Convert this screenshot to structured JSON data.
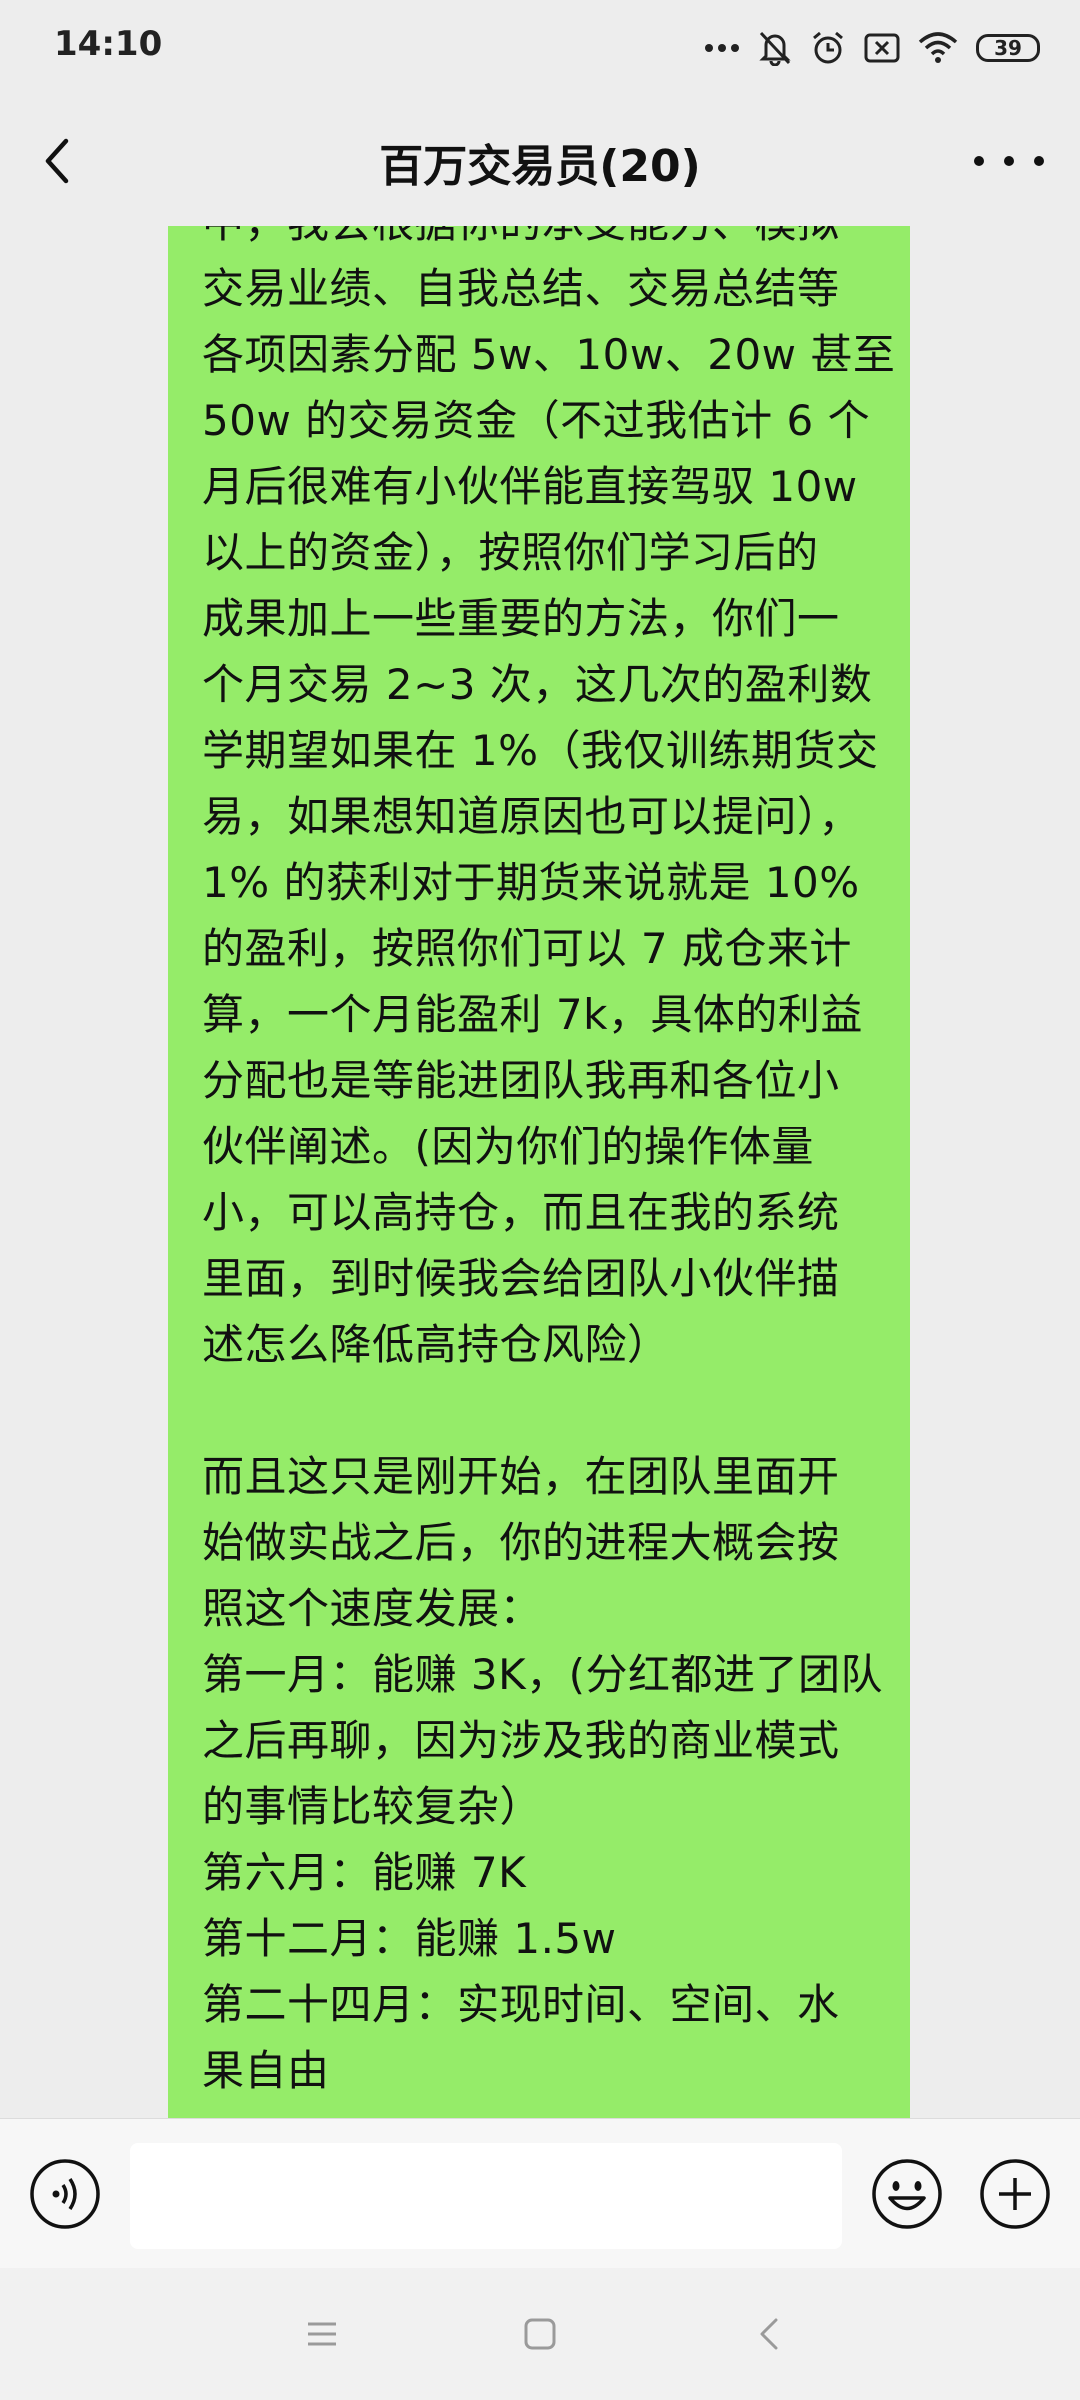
{
  "status_bar": {
    "time": "14:10",
    "battery": "39",
    "icons": [
      "more-dots-icon",
      "mute-bell-icon",
      "alarm-icon",
      "sim-x-icon",
      "wifi-icon",
      "battery-icon"
    ]
  },
  "header": {
    "title": "百万交易员(20)",
    "back_icon": "chevron-left-icon",
    "more_icon": "more-horizontal-icon"
  },
  "message": {
    "lines": [
      "中，我会根据你的承受能力、模拟",
      "交易业绩、自我总结、交易总结等",
      "各项因素分配 5w、10w、20w 甚至",
      "50w 的交易资金（不过我估计 6 个",
      "月后很难有小伙伴能直接驾驭 10w",
      "以上的资金），按照你们学习后的",
      "成果加上一些重要的方法，你们一",
      "个月交易 2~3 次，这几次的盈利数",
      "学期望如果在 1%（我仅训练期货交",
      "易，如果想知道原因也可以提问），",
      "1% 的获利对于期货来说就是 10%",
      "的盈利，按照你们可以 7 成仓来计",
      "算，一个月能盈利 7k，具体的利益",
      "分配也是等能进团队我再和各位小",
      "伙伴阐述。(因为你们的操作体量",
      "小，可以高持仓，而且在我的系统",
      "里面，到时候我会给团队小伙伴描",
      "述怎么降低高持仓风险）",
      "",
      "而且这只是刚开始，在团队里面开",
      "始做实战之后，你的进程大概会按",
      "照这个速度发展：",
      "第一月：能赚 3K，(分红都进了团队",
      "之后再聊，因为涉及我的商业模式",
      "的事情比较复杂）",
      "第六月：能赚 7K",
      "第十二月：能赚 1.5w",
      "第二十四月：实现时间、空间、水",
      "果自由"
    ],
    "bubble_color": "#95ec69"
  },
  "input_bar": {
    "voice_icon": "voice-icon",
    "input_value": "",
    "emoji_icon": "emoji-icon",
    "plus_icon": "plus-circle-icon"
  },
  "system_nav": {
    "icons": [
      "menu-icon",
      "home-square-icon",
      "back-chevron-icon"
    ]
  },
  "colors": {
    "background": "#ededed",
    "bubble": "#95ec69",
    "input_bar": "#f7f7f7"
  }
}
